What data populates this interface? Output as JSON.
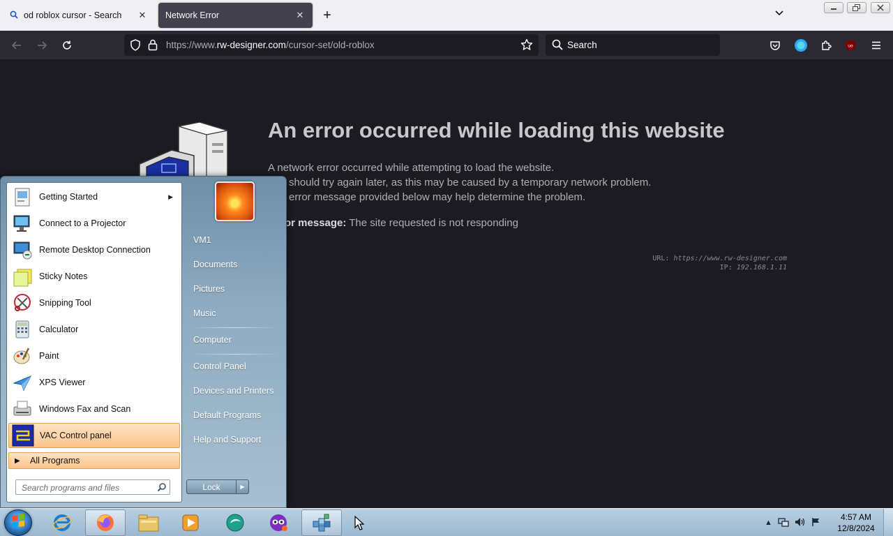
{
  "browser": {
    "tabs": [
      {
        "title": "od roblox cursor - Search",
        "active": false,
        "icon": "search-icon"
      },
      {
        "title": "Network Error",
        "active": true
      }
    ],
    "url": {
      "scheme_prefix": "https://www.",
      "host": "rw-designer.com",
      "path": "/cursor-set/old-roblox"
    },
    "search_placeholder": "Search"
  },
  "error_page": {
    "title": "An error occurred while loading this website",
    "lines": [
      "A network error occurred while attempting to load the website.",
      "should try again later, as this may be caused by a temporary network problem.",
      "error message provided below may help determine the problem."
    ],
    "message_label": "or message:",
    "message_text": " The site requested is not responding",
    "url_label": "URL:",
    "url_value": "https://www.rw-designer.com",
    "ip_label": "IP:",
    "ip_value": "192.168.1.11"
  },
  "start_menu": {
    "programs": [
      {
        "label": "Getting Started",
        "icon": "getting-started-icon",
        "submenu": true
      },
      {
        "label": "Connect to a Projector",
        "icon": "projector-icon"
      },
      {
        "label": "Remote Desktop Connection",
        "icon": "remote-desktop-icon"
      },
      {
        "label": "Sticky Notes",
        "icon": "sticky-notes-icon"
      },
      {
        "label": "Snipping Tool",
        "icon": "snipping-tool-icon"
      },
      {
        "label": "Calculator",
        "icon": "calculator-icon"
      },
      {
        "label": "Paint",
        "icon": "paint-icon"
      },
      {
        "label": "XPS Viewer",
        "icon": "xps-viewer-icon"
      },
      {
        "label": "Windows Fax and Scan",
        "icon": "fax-scan-icon"
      },
      {
        "label": "VAC Control panel",
        "icon": "vac-icon",
        "highlighted": true
      }
    ],
    "all_programs": "All Programs",
    "search_placeholder": "Search programs and files",
    "places": [
      "VM1",
      "Documents",
      "Pictures",
      "Music",
      "Computer",
      "Control Panel",
      "Devices and Printers",
      "Default Programs",
      "Help and Support"
    ],
    "lock_label": "Lock"
  },
  "taskbar": {
    "clock_time": "4:57 AM",
    "clock_date": "12/8/2024"
  }
}
